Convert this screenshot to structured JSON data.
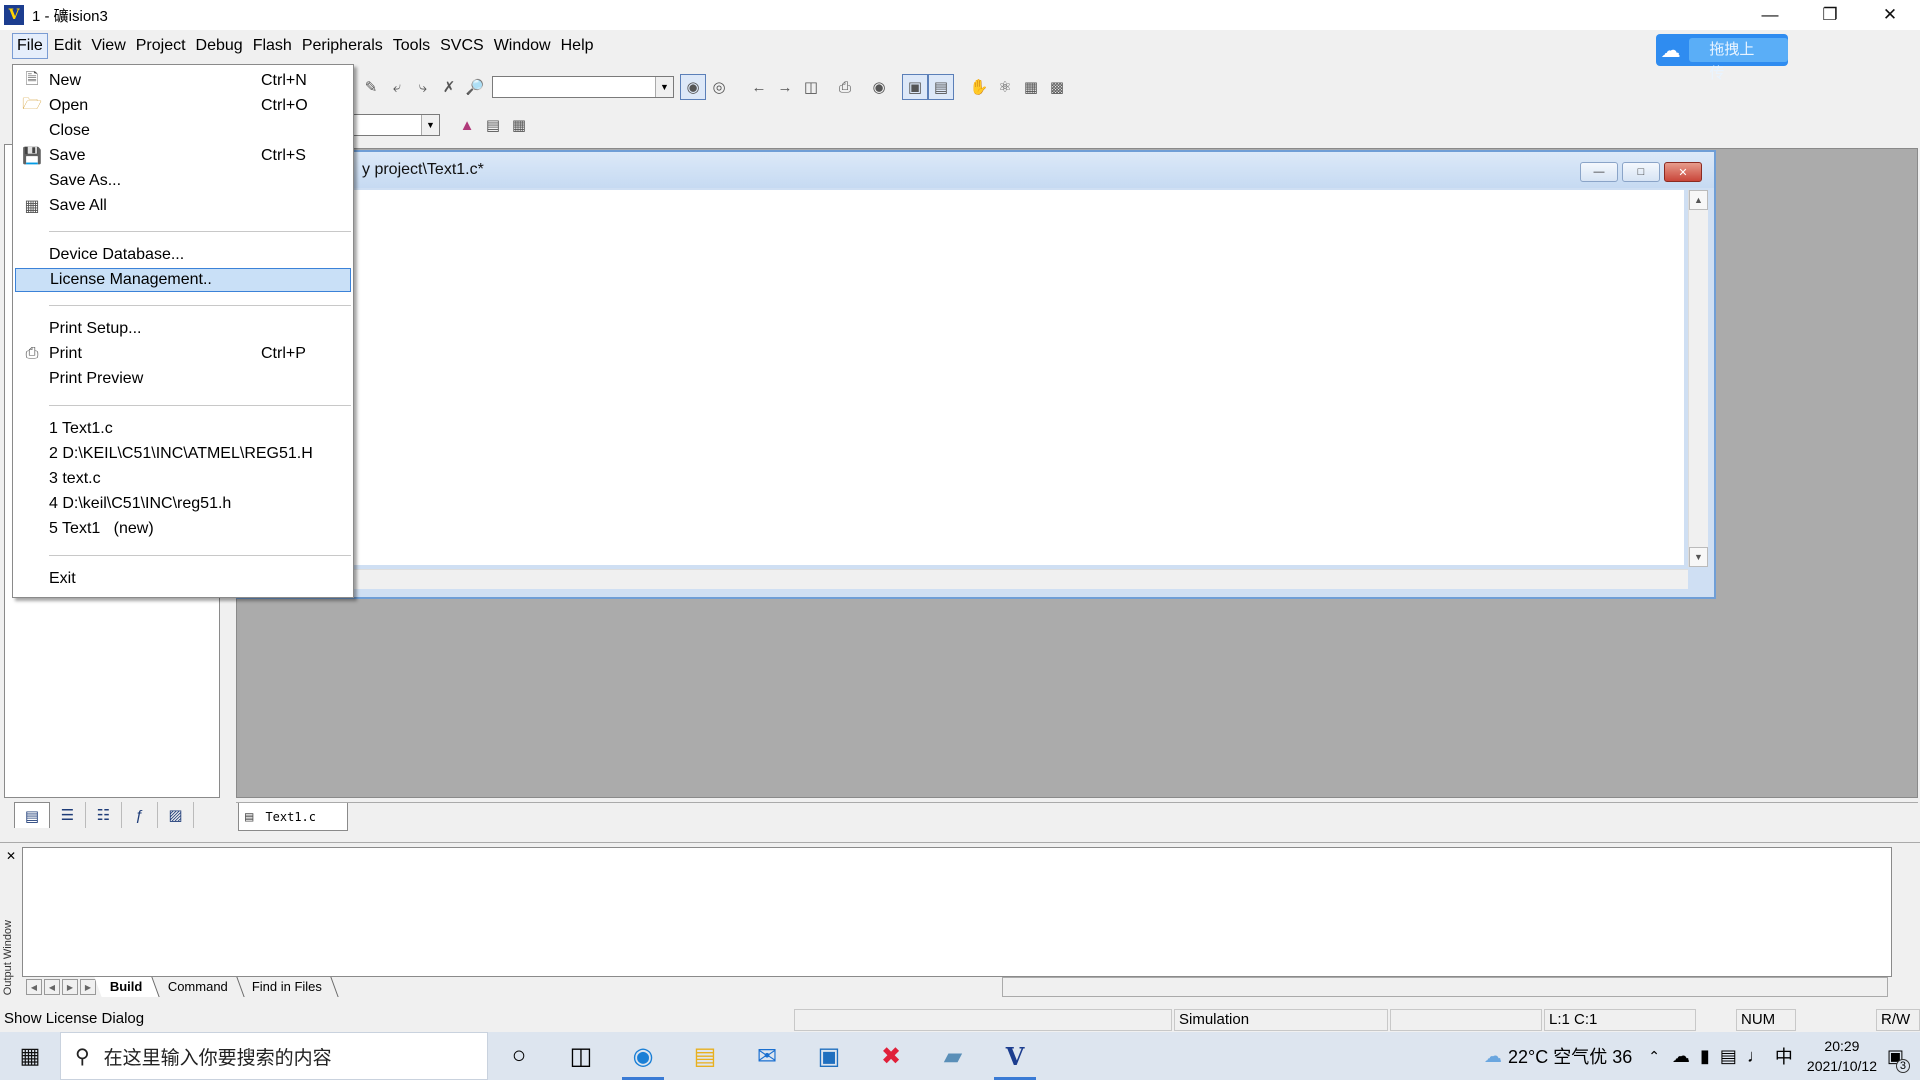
{
  "window": {
    "title": "1 - 礦ision3",
    "app_icon": "V"
  },
  "menubar": [
    "File",
    "Edit",
    "View",
    "Project",
    "Debug",
    "Flash",
    "Peripherals",
    "Tools",
    "SVCS",
    "Window",
    "Help"
  ],
  "upload_button": {
    "label": "拖拽上传",
    "icon": "cloud-icon"
  },
  "file_menu": {
    "items": [
      {
        "label": "New",
        "shortcut": "Ctrl+N",
        "icon": "new-file-icon"
      },
      {
        "label": "Open",
        "shortcut": "Ctrl+O",
        "icon": "open-folder-icon"
      },
      {
        "label": "Close",
        "shortcut": "",
        "icon": ""
      },
      {
        "label": "Save",
        "shortcut": "Ctrl+S",
        "icon": "save-icon"
      },
      {
        "label": "Save As...",
        "shortcut": "",
        "icon": ""
      },
      {
        "label": "Save All",
        "shortcut": "",
        "icon": "save-all-icon"
      },
      {
        "label": "Device Database...",
        "shortcut": "",
        "icon": ""
      },
      {
        "label": "License Management..",
        "shortcut": "",
        "icon": "",
        "highlighted": true
      },
      {
        "label": "Print Setup...",
        "shortcut": "",
        "icon": ""
      },
      {
        "label": "Print",
        "shortcut": "Ctrl+P",
        "icon": "printer-icon"
      },
      {
        "label": "Print Preview",
        "shortcut": "",
        "icon": ""
      },
      {
        "label": "1 Text1.c",
        "shortcut": "",
        "icon": ""
      },
      {
        "label": "2 D:\\KEIL\\C51\\INC\\ATMEL\\REG51.H",
        "shortcut": "",
        "icon": ""
      },
      {
        "label": "3 text.c",
        "shortcut": "",
        "icon": ""
      },
      {
        "label": "4 D:\\keil\\C51\\INC\\reg51.h",
        "shortcut": "",
        "icon": ""
      },
      {
        "label": "5 Text1   (new)",
        "shortcut": "",
        "icon": ""
      },
      {
        "label": "Exit",
        "shortcut": "",
        "icon": ""
      }
    ]
  },
  "document_window": {
    "title": "y project\\Text1.c*"
  },
  "doc_tab": {
    "label": "Text1.c"
  },
  "output_window": {
    "title": "Output Window",
    "tabs": [
      "Build",
      "Command",
      "Find in Files"
    ],
    "selected_tab": "Build"
  },
  "statusbar": {
    "message": "Show License Dialog",
    "mode": "Simulation",
    "position": "L:1 C:1",
    "num": "NUM",
    "rw": "R/W"
  },
  "taskbar": {
    "search_placeholder": "在这里输入你要搜索的内容",
    "weather": "22°C 空气优 36",
    "ime": "中",
    "time": "20:29",
    "date": "2021/10/12",
    "notifications": "3"
  },
  "colors": {
    "accent": "#3b82d8",
    "mdi_bg": "#ababab",
    "upload_blue": "#2f8cf0"
  }
}
